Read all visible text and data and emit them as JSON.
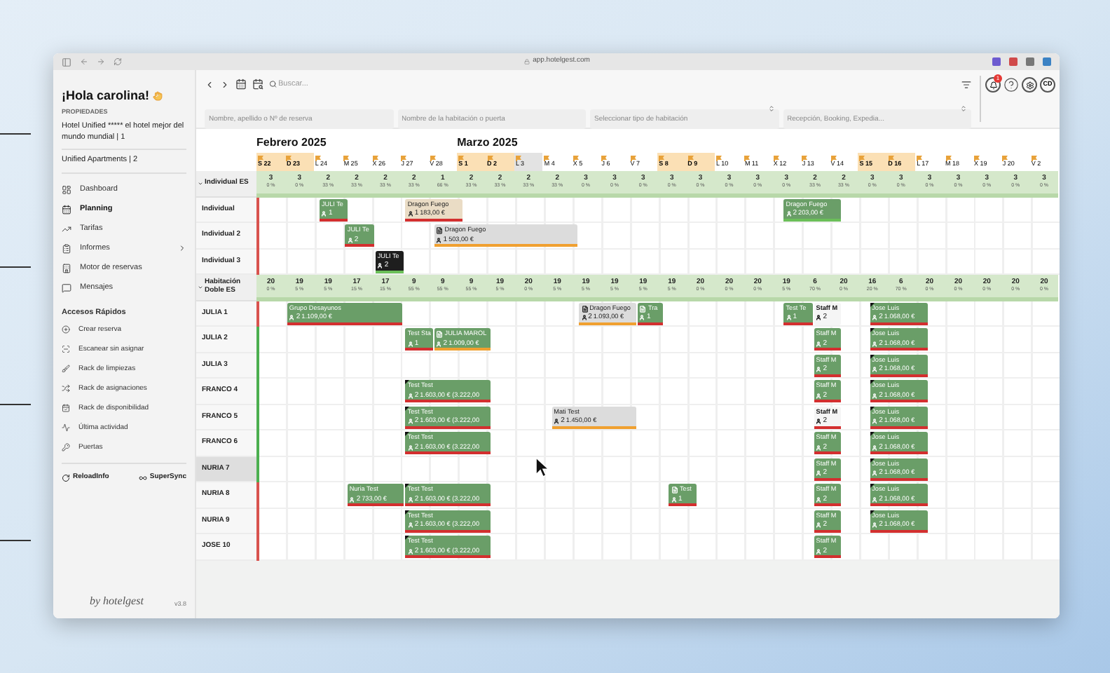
{
  "browser": {
    "url": "app.hotelgest.com"
  },
  "sidebar": {
    "greeting": "¡Hola carolina!",
    "section": "PROPIEDADES",
    "properties": [
      {
        "name": "Hotel Unified ***** el hotel mejor del mundo mundial | 1"
      },
      {
        "name": "Unified Apartments | 2"
      }
    ],
    "nav": [
      {
        "label": "Dashboard",
        "selected": false,
        "submenu": false
      },
      {
        "label": "Planning",
        "selected": true,
        "submenu": false
      },
      {
        "label": "Tarifas",
        "selected": false,
        "submenu": false
      },
      {
        "label": "Informes",
        "selected": false,
        "submenu": true
      },
      {
        "label": "Motor de reservas",
        "selected": false,
        "submenu": false
      },
      {
        "label": "Mensajes",
        "selected": false,
        "submenu": false
      }
    ],
    "quick_title": "Accesos Rápidos",
    "quick": [
      {
        "label": "Crear reserva"
      },
      {
        "label": "Escanear sin asignar"
      },
      {
        "label": "Rack de limpiezas"
      },
      {
        "label": "Rack de asignaciones"
      },
      {
        "label": "Rack de disponibilidad"
      },
      {
        "label": "Última actividad"
      },
      {
        "label": "Puertas"
      }
    ],
    "actions": [
      {
        "label": "ReloadInfo"
      },
      {
        "label": "SuperSync"
      }
    ],
    "logo": "by hotelgest",
    "version": "v3.8"
  },
  "toolbar": {
    "search_placeholder": "Buscar...",
    "notification_badge": "1",
    "avatar": "CD",
    "filters": [
      {
        "placeholder": "Nombre, apellido o Nº de reserva",
        "kind": "text"
      },
      {
        "placeholder": "Nombre de la habitación o puerta",
        "kind": "text"
      },
      {
        "placeholder": "Seleccionar tipo de habitación",
        "kind": "select"
      },
      {
        "placeholder": "Recepción, Booking, Expedia...",
        "kind": "select"
      }
    ]
  },
  "calendar": {
    "months": [
      {
        "label": "Febrero 2025"
      },
      {
        "label": "Marzo 2025"
      }
    ],
    "days": [
      {
        "label": "S 22",
        "kind": "weekend"
      },
      {
        "label": "D 23",
        "kind": "weekend"
      },
      {
        "label": "L 24",
        "kind": "weekday"
      },
      {
        "label": "M 25",
        "kind": "weekday"
      },
      {
        "label": "X 26",
        "kind": "weekday"
      },
      {
        "label": "J 27",
        "kind": "weekday"
      },
      {
        "label": "V 28",
        "kind": "weekday"
      },
      {
        "label": "S 1",
        "kind": "weekend"
      },
      {
        "label": "D 2",
        "kind": "weekend"
      },
      {
        "label": "L 3",
        "kind": "today"
      },
      {
        "label": "M 4",
        "kind": "weekday"
      },
      {
        "label": "X 5",
        "kind": "weekday"
      },
      {
        "label": "J 6",
        "kind": "weekday"
      },
      {
        "label": "V 7",
        "kind": "weekday"
      },
      {
        "label": "S 8",
        "kind": "weekend"
      },
      {
        "label": "D 9",
        "kind": "weekend"
      },
      {
        "label": "L 10",
        "kind": "weekday"
      },
      {
        "label": "M 11",
        "kind": "weekday"
      },
      {
        "label": "X 12",
        "kind": "weekday"
      },
      {
        "label": "J 13",
        "kind": "weekday"
      },
      {
        "label": "V 14",
        "kind": "weekday"
      },
      {
        "label": "S 15",
        "kind": "weekend"
      },
      {
        "label": "D 16",
        "kind": "weekend"
      },
      {
        "label": "L 17",
        "kind": "weekday"
      },
      {
        "label": "M 18",
        "kind": "weekday"
      },
      {
        "label": "X 19",
        "kind": "weekday"
      },
      {
        "label": "J 20",
        "kind": "weekday"
      },
      {
        "label": "V 2",
        "kind": "weekday"
      }
    ],
    "groups": [
      {
        "name": "Individual ES",
        "expanded": true,
        "availability": [
          [
            "3",
            "0 %"
          ],
          [
            "3",
            "0 %"
          ],
          [
            "2",
            "33 %"
          ],
          [
            "2",
            "33 %"
          ],
          [
            "2",
            "33 %"
          ],
          [
            "2",
            "33 %"
          ],
          [
            "1",
            "66 %"
          ],
          [
            "2",
            "33 %"
          ],
          [
            "2",
            "33 %"
          ],
          [
            "2",
            "33 %"
          ],
          [
            "2",
            "33 %"
          ],
          [
            "3",
            "0 %"
          ],
          [
            "3",
            "0 %"
          ],
          [
            "3",
            "0 %"
          ],
          [
            "3",
            "0 %"
          ],
          [
            "3",
            "0 %"
          ],
          [
            "3",
            "0 %"
          ],
          [
            "3",
            "0 %"
          ],
          [
            "3",
            "0 %"
          ],
          [
            "2",
            "33 %"
          ],
          [
            "2",
            "33 %"
          ],
          [
            "3",
            "0 %"
          ],
          [
            "3",
            "0 %"
          ],
          [
            "3",
            "0 %"
          ],
          [
            "3",
            "0 %"
          ],
          [
            "3",
            "0 %"
          ],
          [
            "3",
            "0 %"
          ],
          [
            "3",
            "0 %"
          ]
        ],
        "rooms": [
          {
            "name": "Individual",
            "color": "#d9534f",
            "selected": false,
            "bookings": [
              {
                "name": "JULI Te",
                "kind": "green",
                "guests": "1",
                "note": false,
                "corner": false,
                "color": "#d32f2f"
              },
              {
                "name": "Dragon Fuego",
                "kind": "beige",
                "guests": "1",
                "price": "183,00 €",
                "note": false,
                "corner": false,
                "color": "#d32f2f"
              },
              {
                "name": "Dragon Fuego",
                "kind": "green",
                "guests": "2",
                "price": "203,00 €",
                "note": false,
                "corner": false,
                "color": "#6bbf59"
              }
            ]
          },
          {
            "name": "Individual 2",
            "color": "#d9534f",
            "selected": false,
            "bookings": [
              {
                "name": "JULI Te",
                "kind": "green",
                "guests": "2",
                "note": false,
                "corner": false,
                "color": "#d32f2f"
              },
              {
                "name": "Dragon Fuego",
                "kind": "grey",
                "guests": "1",
                "price": "503,00 €",
                "note": true,
                "corner": false,
                "color": "#f0a030"
              }
            ]
          },
          {
            "name": "Individual 3",
            "color": "#d9534f",
            "selected": false,
            "bookings": [
              {
                "name": "JULI Te",
                "kind": "black",
                "guests": "2",
                "note": false,
                "corner": false,
                "color": "#6bbf59"
              }
            ]
          }
        ]
      },
      {
        "name": "Habitación Doble ES",
        "expanded": true,
        "availability": [
          [
            "20",
            "0 %"
          ],
          [
            "19",
            "5 %"
          ],
          [
            "19",
            "5 %"
          ],
          [
            "17",
            "15 %"
          ],
          [
            "17",
            "15 %"
          ],
          [
            "9",
            "55 %"
          ],
          [
            "9",
            "55 %"
          ],
          [
            "9",
            "55 %"
          ],
          [
            "19",
            "5 %"
          ],
          [
            "20",
            "0 %"
          ],
          [
            "19",
            "5 %"
          ],
          [
            "19",
            "5 %"
          ],
          [
            "19",
            "5 %"
          ],
          [
            "19",
            "5 %"
          ],
          [
            "19",
            "5 %"
          ],
          [
            "20",
            "0 %"
          ],
          [
            "20",
            "0 %"
          ],
          [
            "20",
            "0 %"
          ],
          [
            "19",
            "5 %"
          ],
          [
            "6",
            "70 %"
          ],
          [
            "20",
            "0 %"
          ],
          [
            "16",
            "20 %"
          ],
          [
            "6",
            "70 %"
          ],
          [
            "20",
            "0 %"
          ],
          [
            "20",
            "0 %"
          ],
          [
            "20",
            "0 %"
          ],
          [
            "20",
            "0 %"
          ],
          [
            "20",
            "0 %"
          ]
        ],
        "rooms": [
          {
            "name": "JULIA 1",
            "color": "#d9534f",
            "selected": false,
            "bookings": [
              {
                "name": "Grupo Desayunos",
                "kind": "green",
                "guests": "2",
                "price": "1.109,00 €",
                "note": false,
                "corner": false,
                "color": "#d32f2f"
              },
              {
                "name": "Dragon Fuego",
                "kind": "grey",
                "guests": "2",
                "price": "1.093,00 €",
                "note": true,
                "corner": false,
                "color": "#f0a030"
              },
              {
                "name": "Tra",
                "kind": "green",
                "guests": "1",
                "note": true,
                "corner": false,
                "color": "#d32f2f"
              },
              {
                "name": "Test Te",
                "kind": "green",
                "guests": "1",
                "note": false,
                "corner": false,
                "color": "#d32f2f"
              },
              {
                "name": "Staff M",
                "kind": "light",
                "guests": "2",
                "note": false,
                "corner": false
              },
              {
                "name": "Jose Luis",
                "kind": "green",
                "guests": "2",
                "price": "1.068,00 €",
                "note": false,
                "corner": true,
                "color": "#d32f2f"
              }
            ]
          },
          {
            "name": "JULIA 2",
            "color": "#4caf50",
            "selected": false,
            "bookings": [
              {
                "name": "Test Sta",
                "kind": "green",
                "guests": "1",
                "note": false,
                "corner": false,
                "color": "#d32f2f"
              },
              {
                "name": "JULIA MAROL",
                "kind": "green",
                "guests": "2",
                "price": "1.009,00 €",
                "note": true,
                "corner": false,
                "color": "#f0a030"
              },
              {
                "name": "Staff M",
                "kind": "green",
                "guests": "2",
                "note": false,
                "corner": false,
                "color": "#d32f2f"
              },
              {
                "name": "Jose Luis",
                "kind": "green",
                "guests": "2",
                "price": "1.068,00 €",
                "note": false,
                "corner": true,
                "color": "#d32f2f"
              }
            ]
          },
          {
            "name": "JULIA 3",
            "color": "#4caf50",
            "selected": false,
            "bookings": [
              {
                "name": "Staff M",
                "kind": "green",
                "guests": "2",
                "note": false,
                "corner": false,
                "color": "#d32f2f"
              },
              {
                "name": "Jose Luis",
                "kind": "green",
                "guests": "2",
                "price": "1.068,00 €",
                "note": false,
                "corner": true,
                "color": "#d32f2f"
              }
            ]
          },
          {
            "name": "FRANCO 4",
            "color": "#4caf50",
            "selected": false,
            "bookings": [
              {
                "name": "Test Test",
                "kind": "green",
                "guests": "2",
                "price": "1.603,00 € (3.222,00",
                "note": false,
                "corner": true,
                "color": "#d32f2f"
              },
              {
                "name": "Staff M",
                "kind": "green",
                "guests": "2",
                "note": false,
                "corner": false,
                "color": "#d32f2f"
              },
              {
                "name": "Jose Luis",
                "kind": "green",
                "guests": "2",
                "price": "1.068,00 €",
                "note": false,
                "corner": true,
                "color": "#d32f2f"
              }
            ]
          },
          {
            "name": "FRANCO 5",
            "color": "#4caf50",
            "selected": false,
            "bookings": [
              {
                "name": "Test Test",
                "kind": "green",
                "guests": "2",
                "price": "1.603,00 € (3.222,00",
                "note": false,
                "corner": true,
                "color": "#d32f2f"
              },
              {
                "name": "Mati Test",
                "kind": "grey",
                "guests": "2",
                "price": "1.450,00 €",
                "note": false,
                "corner": false,
                "color": "#f0a030"
              },
              {
                "name": "Staff M",
                "kind": "light",
                "guests": "2",
                "note": false,
                "corner": false,
                "color": "#d32f2f"
              },
              {
                "name": "Jose Luis",
                "kind": "green",
                "guests": "2",
                "price": "1.068,00 €",
                "note": false,
                "corner": true,
                "color": "#d32f2f"
              }
            ]
          },
          {
            "name": "FRANCO 6",
            "color": "#4caf50",
            "selected": false,
            "bookings": [
              {
                "name": "Test Test",
                "kind": "green",
                "guests": "2",
                "price": "1.603,00 € (3.222,00",
                "note": false,
                "corner": true,
                "color": "#d32f2f"
              },
              {
                "name": "Staff M",
                "kind": "green",
                "guests": "2",
                "note": false,
                "corner": false,
                "color": "#d32f2f"
              },
              {
                "name": "Jose Luis",
                "kind": "green",
                "guests": "2",
                "price": "1.068,00 €",
                "note": false,
                "corner": true,
                "color": "#d32f2f"
              }
            ]
          },
          {
            "name": "NURIA 7",
            "color": "#4caf50",
            "selected": true,
            "bookings": [
              {
                "name": "Staff M",
                "kind": "green",
                "guests": "2",
                "note": false,
                "corner": false,
                "color": "#d32f2f"
              },
              {
                "name": "Jose Luis",
                "kind": "green",
                "guests": "2",
                "price": "1.068,00 €",
                "note": false,
                "corner": true,
                "color": "#d32f2f"
              }
            ]
          },
          {
            "name": "NURIA 8",
            "color": "#d9534f",
            "selected": false,
            "bookings": [
              {
                "name": "Nuria Test",
                "kind": "green",
                "guests": "2",
                "price": "733,00 €",
                "note": false,
                "corner": false,
                "color": "#d32f2f"
              },
              {
                "name": "Test Test",
                "kind": "green",
                "guests": "2",
                "price": "1.603,00 € (3.222,00",
                "note": false,
                "corner": true,
                "color": "#d32f2f"
              },
              {
                "name": "Test",
                "kind": "green",
                "guests": "1",
                "note": true,
                "corner": false,
                "color": "#d32f2f"
              },
              {
                "name": "Staff M",
                "kind": "green",
                "guests": "2",
                "note": false,
                "corner": false,
                "color": "#d32f2f"
              },
              {
                "name": "Jose Luis",
                "kind": "green",
                "guests": "2",
                "price": "1.068,00 €",
                "note": false,
                "corner": true,
                "color": "#d32f2f"
              }
            ]
          },
          {
            "name": "NURIA 9",
            "color": "#d9534f",
            "selected": false,
            "bookings": [
              {
                "name": "Test Test",
                "kind": "green",
                "guests": "2",
                "price": "1.603,00 € (3.222,00",
                "note": false,
                "corner": true,
                "color": "#d32f2f"
              },
              {
                "name": "Staff M",
                "kind": "green",
                "guests": "2",
                "note": false,
                "corner": false,
                "color": "#d32f2f"
              },
              {
                "name": "Jose Luis",
                "kind": "green",
                "guests": "2",
                "price": "1.068,00 €",
                "note": false,
                "corner": true,
                "color": "#d32f2f"
              }
            ]
          },
          {
            "name": "JOSE 10",
            "color": "#d9534f",
            "selected": false,
            "bookings": [
              {
                "name": "Test Test",
                "kind": "green",
                "guests": "2",
                "price": "1.603,00 € (3.222,00",
                "note": false,
                "corner": true,
                "color": "#d32f2f"
              },
              {
                "name": "Staff M",
                "kind": "green",
                "guests": "2",
                "note": false,
                "corner": false,
                "color": "#d32f2f"
              }
            ]
          }
        ]
      }
    ]
  }
}
